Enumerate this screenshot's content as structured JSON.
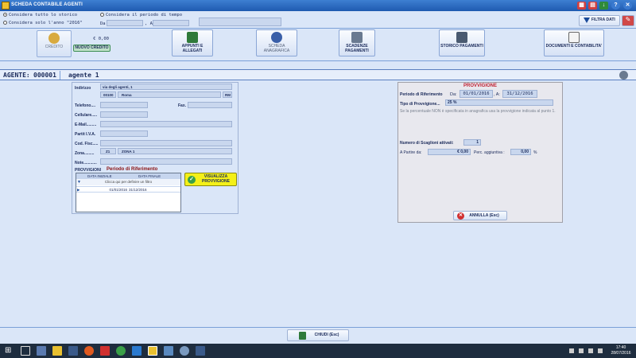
{
  "window": {
    "title": "SCHEDA CONTABILE AGENTI"
  },
  "options": {
    "storico_all": "Considera tutto lo storico",
    "storico_year": "Considera solo l'anno \"2016\"",
    "periodo": "Considera il periodo di tempo",
    "da_label": "Da",
    "a_label": ", A"
  },
  "filtra": {
    "label": "FILTRA DATI"
  },
  "credito": {
    "label": "CREDITO",
    "value": "€ 0,00",
    "new_label": "NUOVO CREDITO"
  },
  "ribbon": [
    {
      "label": "APPUNTI E ALLEGATI"
    },
    {
      "label": "SCHEDA ANAGRAFICA"
    },
    {
      "label": "SCADENZE PAGAMENTI"
    },
    {
      "label": "STORICO PAGAMENTI"
    },
    {
      "label": "DOCUMENTI E CONTABILITA'"
    }
  ],
  "agent": {
    "label": "AGENTE:",
    "code": "000001",
    "name": "agente 1"
  },
  "anagrafica": {
    "indirizzo_label": "Indirizzo",
    "indirizzo": "via degli agenti, 1",
    "cap": "00100",
    "citta": "Roma",
    "prov": "RM",
    "telefono_label": "Telefono....",
    "fax_label": "Fax.",
    "cellulare_label": "Cellulare.....",
    "email_label": "E-Mail.........",
    "piva_label": "Partit I.V.A.",
    "codfisc_label": "Cod. Fisc.....",
    "zona_label": "Zona.........",
    "zona_code": "Z1",
    "zona_name": "ZONA 1",
    "note_label": "Note............"
  },
  "provvigioni_left": {
    "label": "PROVVIGIONI",
    "title": "Periodo di Riferimento",
    "col_start": "DATA INIZIALE",
    "col_end": "DATA FINALE",
    "filter_hint": "Clicca qui per definire un filtro",
    "row_start": "01/01/2016",
    "row_end": "31/12/2016",
    "view_btn": "VISUALIZZA PROVVIGIONE"
  },
  "provvigione": {
    "title": "PROVVIGIONE",
    "periodo_label": "Periodo di Riferimento",
    "da": "Da:",
    "da_val": "01/01/2016",
    "a": ", A:",
    "a_val": "31/12/2016",
    "tipo_label": "Tipo di Provvigione...",
    "tipo_val": "25 %",
    "note": "Se la percentuale NON è specificata in anagrafica usa la provvigione indicata al punto 1.",
    "scaglioni_label": "Numero di Scaglioni attivati:",
    "scaglioni_val": "1",
    "partire_label": "A Partire da:",
    "partire_val": "€ 0,00",
    "perc_label": "Perc. aggiuntiva :",
    "perc_val": "0,00",
    "perc_unit": "%",
    "annulla": "ANNULLA (Esc)"
  },
  "footer": {
    "chiudi": "CHIUDI (Esc)"
  },
  "taskbar": {
    "time": "17:40",
    "date": "28/07/2016"
  }
}
